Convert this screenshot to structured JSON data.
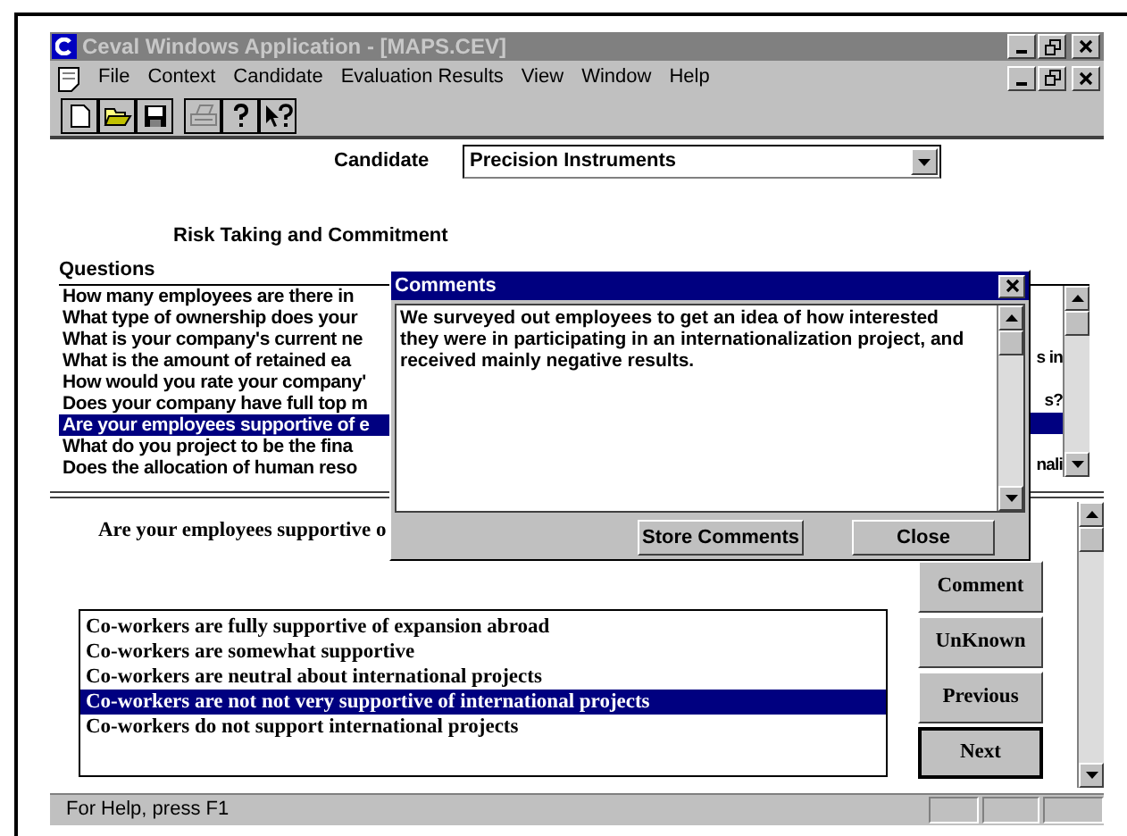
{
  "window": {
    "title": "Ceval Windows Application - [MAPS.CEV]"
  },
  "menu": [
    "File",
    "Context",
    "Candidate",
    "Evaluation Results",
    "View",
    "Window",
    "Help"
  ],
  "toolbar": [
    {
      "kind": "new",
      "disabled": false
    },
    {
      "kind": "open",
      "disabled": false
    },
    {
      "kind": "save",
      "disabled": false
    },
    {
      "kind": "print",
      "disabled": true
    },
    {
      "kind": "help",
      "disabled": false
    },
    {
      "kind": "context-help",
      "disabled": false
    }
  ],
  "candidate": {
    "label": "Candidate",
    "value": "Precision Instruments"
  },
  "section_title": "Risk Taking and Commitment",
  "questions": {
    "label": "Questions",
    "items": [
      {
        "text": "How many employees are there in",
        "selected": false
      },
      {
        "text": "What type of ownership does your",
        "selected": false
      },
      {
        "text": "What is your company's current ne",
        "selected": false
      },
      {
        "text": "What is the amount of retained ea",
        "tail": "s in",
        "selected": false
      },
      {
        "text": "How would you rate your company'",
        "selected": false
      },
      {
        "text": "Does your company have full top m",
        "tail": "s?",
        "selected": false
      },
      {
        "text": "Are your employees supportive of e",
        "selected": true
      },
      {
        "text": "What do you project to be the fina",
        "selected": false
      },
      {
        "text": "Does the allocation of human reso",
        "tail": "nali",
        "selected": false
      }
    ]
  },
  "comments_dialog": {
    "title": "Comments",
    "text": "We surveyed out employees to get an idea of how interested they were in participating in an internationalization project, and received mainly negative results.",
    "buttons": [
      "Store Comments",
      "Close"
    ]
  },
  "current_question": "Are your employees supportive o",
  "answers": [
    {
      "text": "Co-workers are fully supportive of expansion abroad",
      "selected": false
    },
    {
      "text": "Co-workers are somewhat supportive",
      "selected": false
    },
    {
      "text": "Co-workers are neutral about international projects",
      "selected": false
    },
    {
      "text": "Co-workers are not not very supportive of international projects",
      "selected": true
    },
    {
      "text": "Co-workers do not support international projects",
      "selected": false
    }
  ],
  "buttons": [
    {
      "label": "Comment",
      "default": false
    },
    {
      "label": "UnKnown",
      "default": false
    },
    {
      "label": "Previous",
      "default": false
    },
    {
      "label": "Next",
      "default": true
    }
  ],
  "status_bar": {
    "text": "For Help, press F1"
  }
}
